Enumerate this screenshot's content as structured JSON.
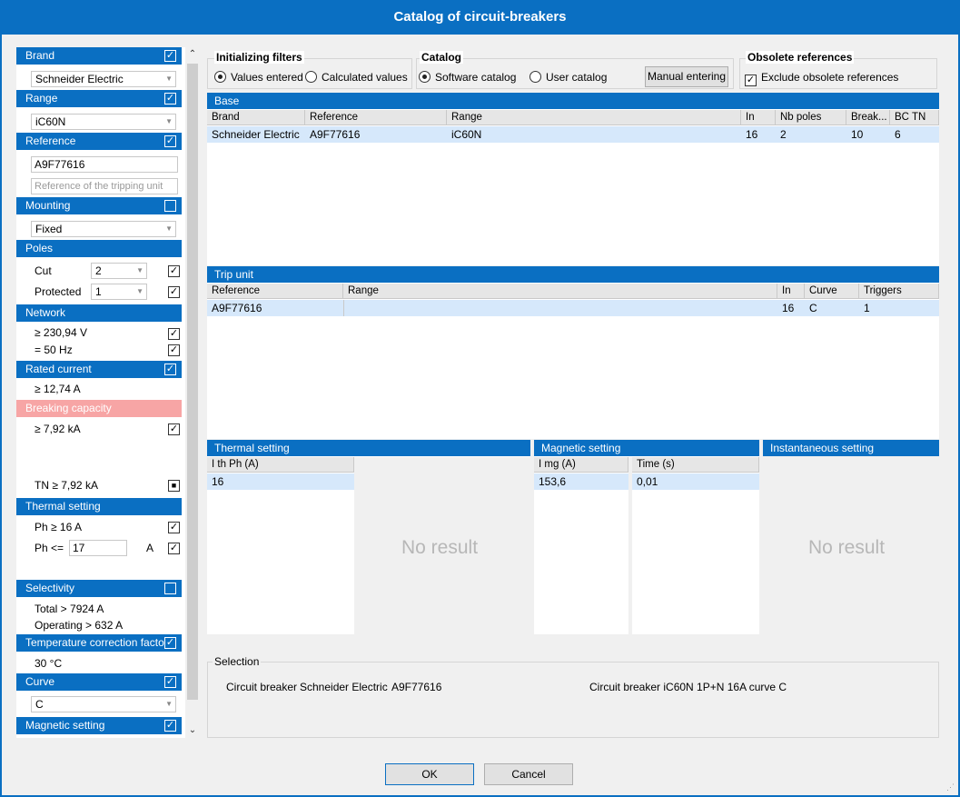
{
  "window": {
    "title": "Catalog of circuit-breakers"
  },
  "filters": {
    "brand": {
      "label": "Brand",
      "checked": true,
      "value": "Schneider Electric"
    },
    "range": {
      "label": "Range",
      "checked": true,
      "value": "iC60N"
    },
    "reference": {
      "label": "Reference",
      "checked": true,
      "value": "A9F77616",
      "placeholder": "Reference of the tripping unit"
    },
    "mounting": {
      "label": "Mounting",
      "checked": false,
      "value": "Fixed"
    },
    "poles": {
      "label": "Poles",
      "cut_label": "Cut",
      "cut_value": "2",
      "protected_label": "Protected",
      "protected_value": "1"
    },
    "network": {
      "label": "Network",
      "voltage": "≥ 230,94 V",
      "frequency": "= 50 Hz"
    },
    "rated_current": {
      "label": "Rated current",
      "checked": true,
      "value": "≥ 12,74 A"
    },
    "breaking_capacity": {
      "label": "Breaking capacity",
      "value": "≥ 7,92 kA",
      "tn_value": "TN ≥ 7,92 kA"
    },
    "thermal_setting": {
      "label": "Thermal setting",
      "ph_min": "Ph ≥ 16 A",
      "ph_max_label": "Ph <=",
      "ph_max_value": "17",
      "unit": "A"
    },
    "selectivity": {
      "label": "Selectivity",
      "checked": false,
      "total": "Total > 7924 A",
      "operating": "Operating > 632 A"
    },
    "temperature": {
      "label": "Temperature correction factor",
      "checked": true,
      "value": "30 °C"
    },
    "curve": {
      "label": "Curve",
      "checked": true,
      "value": "C"
    },
    "magnetic_setting": {
      "label": "Magnetic setting",
      "checked": true
    }
  },
  "initializing_filters": {
    "label": "Initializing filters",
    "options": [
      "Values entered",
      "Calculated values"
    ],
    "selected": "Values entered"
  },
  "catalog": {
    "label": "Catalog",
    "options": [
      "Software catalog",
      "User catalog"
    ],
    "selected": "Software catalog",
    "manual_button": "Manual entering"
  },
  "obsolete": {
    "label": "Obsolete references",
    "option": "Exclude obsolete references",
    "checked": true
  },
  "base": {
    "title": "Base",
    "columns": [
      "Brand",
      "Reference",
      "Range",
      "In",
      "Nb poles",
      "Break...",
      "BC TN"
    ],
    "rows": [
      [
        "Schneider Electric",
        "A9F77616",
        "iC60N",
        "16",
        "2",
        "10",
        "6"
      ]
    ]
  },
  "trip_unit": {
    "title": "Trip unit",
    "columns": [
      "Reference",
      "Range",
      "In",
      "Curve",
      "Triggers"
    ],
    "rows": [
      [
        "A9F77616",
        "",
        "16",
        "C",
        "1"
      ]
    ]
  },
  "thermal": {
    "title": "Thermal setting",
    "column": "I th Ph (A)",
    "value": "16",
    "empty": "No result"
  },
  "magnetic": {
    "title": "Magnetic setting",
    "columns": [
      "I mg (A)",
      "Time (s)"
    ],
    "values": [
      "153,6",
      "0,01"
    ]
  },
  "instantaneous": {
    "title": "Instantaneous setting",
    "empty": "No result"
  },
  "selection": {
    "label": "Selection",
    "type": "Circuit breaker",
    "brand": "Schneider Electric",
    "reference": "A9F77616",
    "description": "Circuit breaker iC60N 1P+N 16A curve C"
  },
  "buttons": {
    "ok": "OK",
    "cancel": "Cancel"
  }
}
